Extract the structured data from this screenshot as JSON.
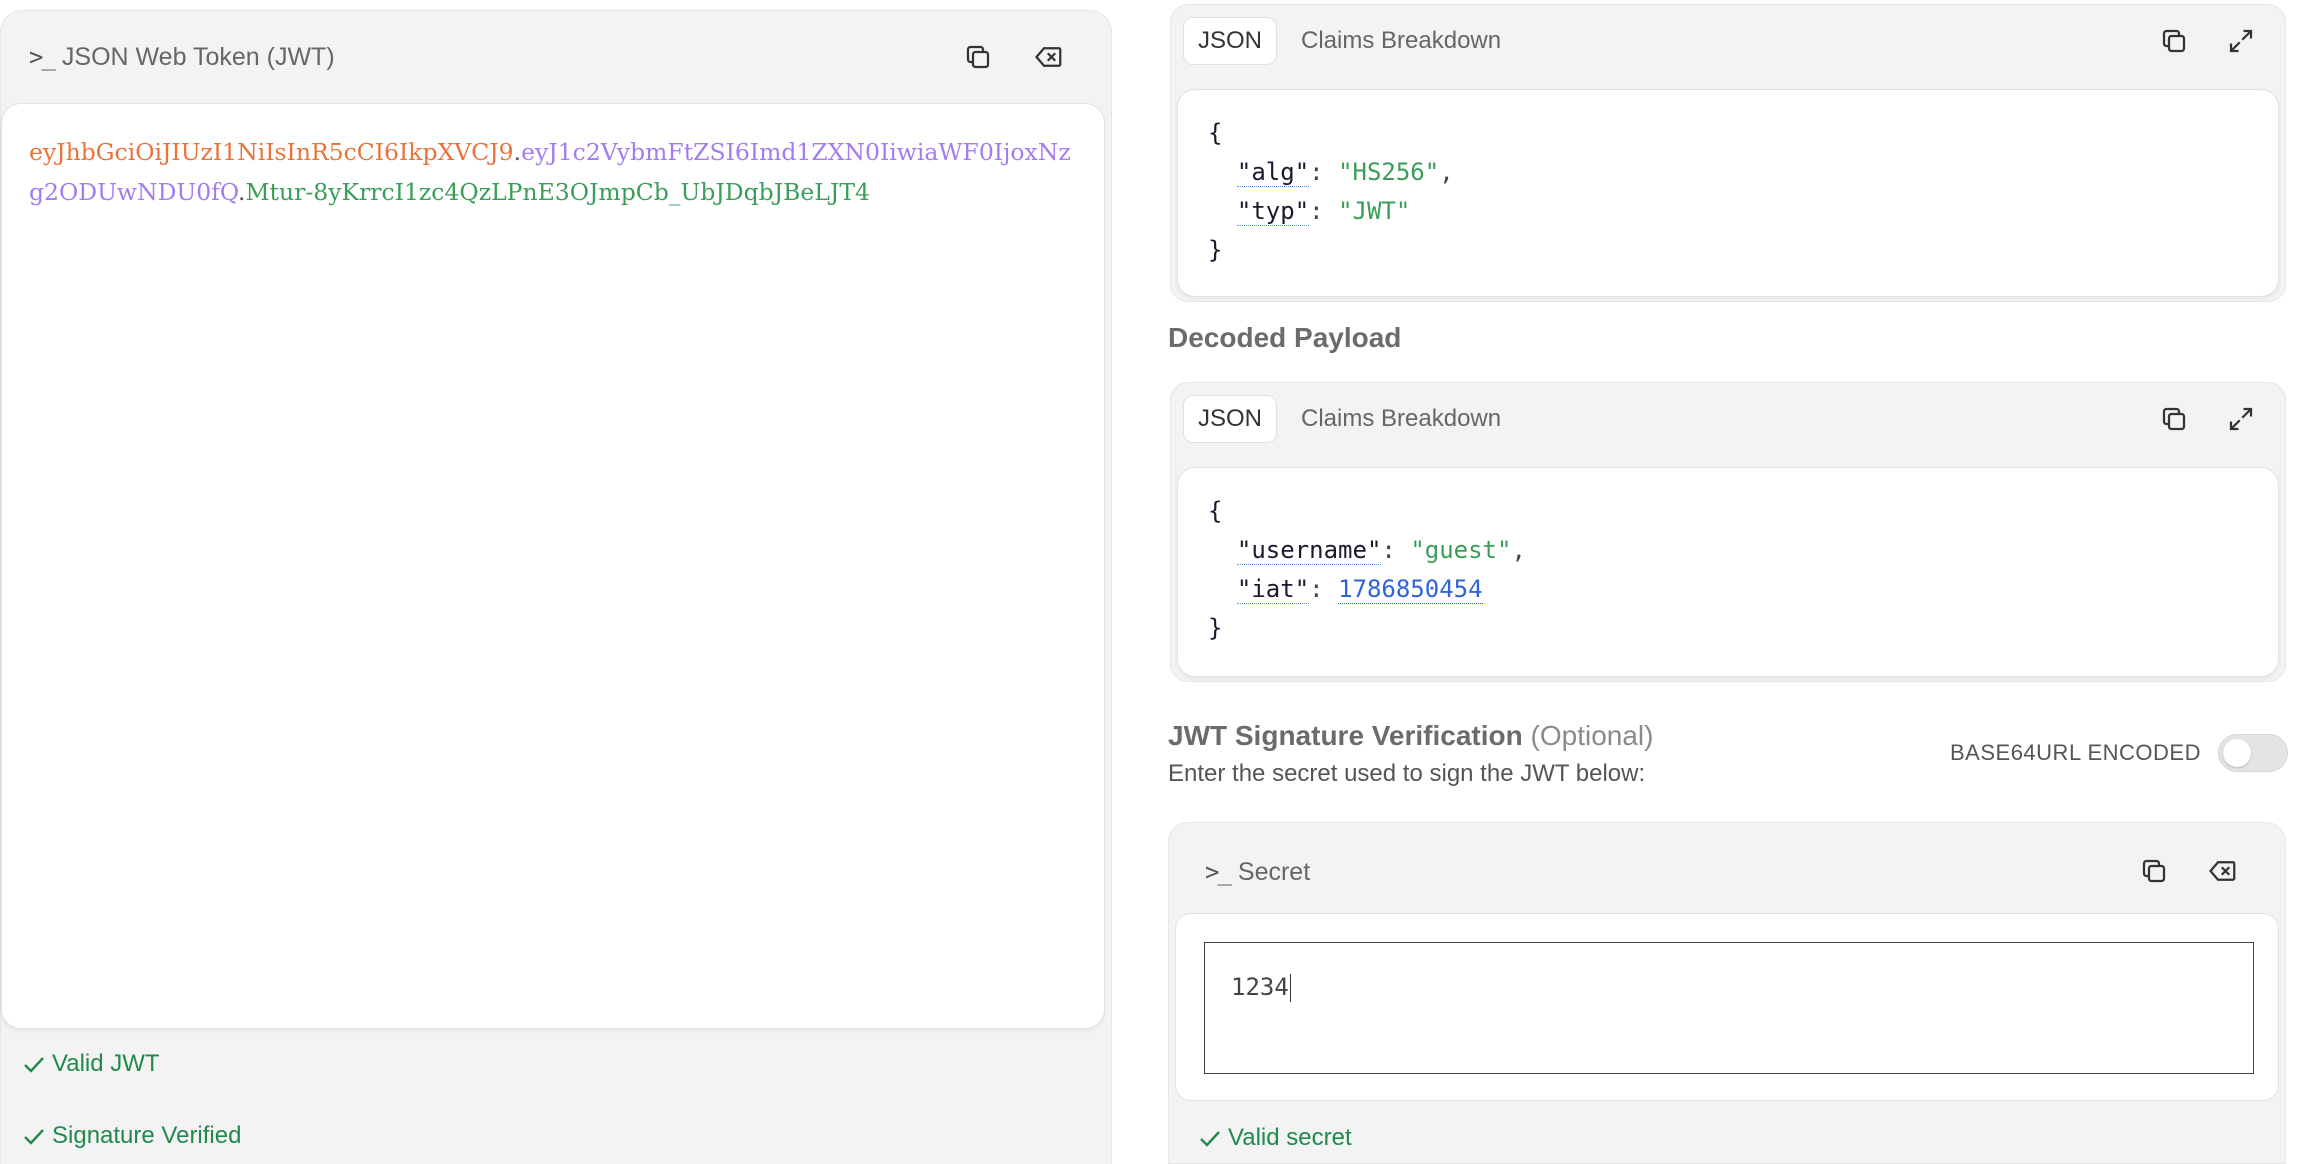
{
  "encoded": {
    "title": "JSON Web Token (JWT)",
    "token_header": "eyJhbGciOiJIUzI1NiIsInR5cCI6IkpXVCJ9",
    "token_payload": "eyJ1c2VybmFtZSI6Imd1ZXN0IiwiaWF0IjoxNzg2ODUwNDU0fQ",
    "token_signature": "Mtur-8yKrrcI1zc4QzLPnE3OJmpCb_UbJDqbJBeLJT4",
    "dot": ".",
    "status_valid": "Valid JWT",
    "status_signature": "Signature Verified"
  },
  "header_card": {
    "tab_json": "JSON",
    "tab_claims": "Claims Breakdown",
    "open_brace": "{",
    "close_brace": "}",
    "alg_key": "\"alg\"",
    "alg_value": "\"HS256\"",
    "typ_key": "\"typ\"",
    "typ_value": "\"JWT\""
  },
  "payload_section": {
    "title": "Decoded Payload"
  },
  "payload_card": {
    "tab_json": "JSON",
    "tab_claims": "Claims Breakdown",
    "open_brace": "{",
    "close_brace": "}",
    "username_key": "\"username\"",
    "username_value": "\"guest\"",
    "iat_key": "\"iat\"",
    "iat_value": "1786850454"
  },
  "verification": {
    "title": "JWT Signature Verification",
    "optional": "(Optional)",
    "subtitle": "Enter the secret used to sign the JWT below:",
    "toggle_label": "BASE64URL ENCODED",
    "toggle_on": false
  },
  "secret": {
    "title": "Secret",
    "value": "1234",
    "status": "Valid secret"
  },
  "colors": {
    "token_header": "#e8743b",
    "token_payload": "#a37cf0",
    "token_signature": "#3a9e58",
    "success": "#1f8a4c"
  }
}
